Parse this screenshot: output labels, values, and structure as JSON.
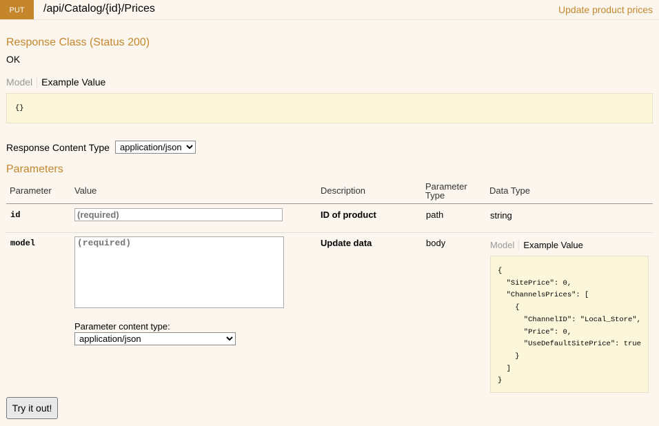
{
  "header": {
    "method": "PUT",
    "path": "/api/Catalog/{id}/Prices",
    "summary": "Update product prices"
  },
  "response_class": {
    "title": "Response Class (Status 200)",
    "status_text": "OK",
    "tabs": {
      "model": "Model",
      "example": "Example Value"
    },
    "example": "{}"
  },
  "response_content_type": {
    "label": "Response Content Type",
    "selected": "application/json"
  },
  "parameters": {
    "title": "Parameters",
    "columns": {
      "parameter": "Parameter",
      "value": "Value",
      "description": "Description",
      "type_line1": "Parameter",
      "type_line2": "Type",
      "data_type": "Data Type"
    },
    "rows": [
      {
        "name": "id",
        "placeholder": "(required)",
        "description": "ID of product",
        "param_type": "path",
        "data_type": "string"
      },
      {
        "name": "model",
        "placeholder": "(required)",
        "description": "Update data",
        "param_type": "body",
        "content_type_label": "Parameter content type:",
        "content_type_selected": "application/json",
        "tabs": {
          "model": "Model",
          "example": "Example Value"
        },
        "example": "{\n  \"SitePrice\": 0,\n  \"ChannelsPrices\": [\n    {\n      \"ChannelID\": \"Local_Store\",\n      \"Price\": 0,\n      \"UseDefaultSitePrice\": true\n    }\n  ]\n}"
      }
    ]
  },
  "try_button": "Try it out!"
}
